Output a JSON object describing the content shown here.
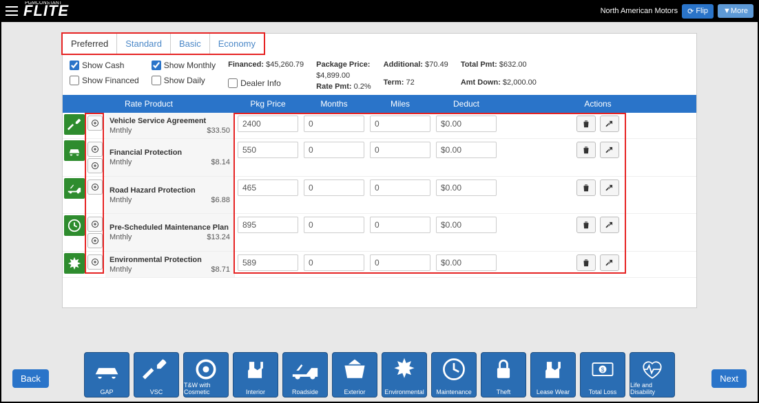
{
  "topbar": {
    "logo_small": "PGMCONSTANT",
    "logo": "FLITE",
    "org": "North American Motors",
    "flip": "Flip",
    "more": "▼More"
  },
  "tabs": [
    "Preferred",
    "Standard",
    "Basic",
    "Economy"
  ],
  "active_tab": 0,
  "options": {
    "show_cash": "Show Cash",
    "show_monthly": "Show Monthly",
    "show_financed": "Show Financed",
    "show_daily": "Show Daily",
    "dealer_info": "Dealer Info"
  },
  "summary": {
    "financed_label": "Financed:",
    "financed_value": "$45,260.79",
    "package_label": "Package Price:",
    "package_value": "$4,899.00",
    "ratepmt_label": "Rate Pmt:",
    "ratepmt_value": "0.2%",
    "additional_label": "Additional:",
    "additional_value": "$70.49",
    "term_label": "Term:",
    "term_value": "72",
    "totalpmt_label": "Total Pmt:",
    "totalpmt_value": "$632.00",
    "amtdown_label": "Amt Down:",
    "amtdown_value": "$2,000.00"
  },
  "headers": {
    "rate_product": "Rate Product",
    "pkg_price": "Pkg Price",
    "months": "Months",
    "miles": "Miles",
    "deduct": "Deduct",
    "actions": "Actions"
  },
  "rows": [
    {
      "icon": "wrench",
      "name": "Vehicle Service Agreement",
      "sub": "Mnthly",
      "amt": "$33.50",
      "pkg": "2400",
      "mon": "0",
      "mil": "0",
      "ded": "$0.00",
      "plus": 1
    },
    {
      "icon": "car",
      "name": "Financial Protection",
      "sub": "Mnthly",
      "amt": "$8.14",
      "pkg": "550",
      "mon": "0",
      "mil": "0",
      "ded": "$0.00",
      "plus": 2,
      "tall": true
    },
    {
      "icon": "tow",
      "name": "Road Hazard Protection",
      "sub": "Mnthly",
      "amt": "$6.88",
      "pkg": "465",
      "mon": "0",
      "mil": "0",
      "ded": "$0.00",
      "plus": 1,
      "tall": true
    },
    {
      "icon": "clock",
      "name": "Pre-Scheduled Maintenance Plan",
      "sub": "Mnthly",
      "amt": "$13.24",
      "pkg": "895",
      "mon": "0",
      "mil": "0",
      "ded": "$0.00",
      "plus": 2,
      "tall": true
    },
    {
      "icon": "burst",
      "name": "Environmental Protection",
      "sub": "Mnthly",
      "amt": "$8.71",
      "pkg": "589",
      "mon": "0",
      "mil": "0",
      "ded": "$0.00",
      "plus": 1
    }
  ],
  "bottom_icons": [
    "GAP",
    "VSC",
    "T&W with Cosmetic",
    "Interior",
    "Roadside",
    "Exterior",
    "Environmental",
    "Maintenance",
    "Theft",
    "Lease Wear",
    "Total Loss",
    "Life and Disability"
  ],
  "nav": {
    "back": "Back",
    "next": "Next"
  }
}
